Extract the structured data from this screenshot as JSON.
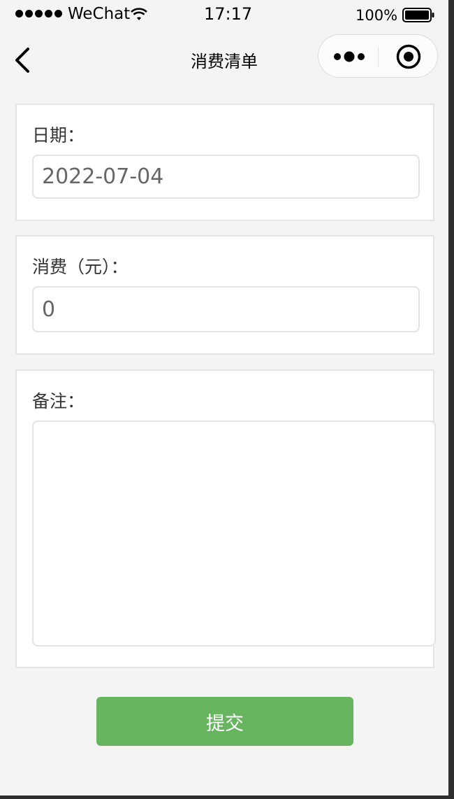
{
  "status_bar": {
    "carrier": "WeChat",
    "time": "17:17",
    "battery": "100%"
  },
  "nav": {
    "title": "消费清单"
  },
  "form": {
    "date_label": "日期：",
    "date_value": "2022-07-04",
    "amount_label": "消费（元）：",
    "amount_value": "0",
    "note_label": "备注：",
    "note_value": ""
  },
  "submit_label": "提交",
  "colors": {
    "accent": "#68b560",
    "background": "#f4f4f5"
  },
  "icons": [
    "signal-icon",
    "wifi-icon",
    "battery-icon",
    "back-icon",
    "more-icon",
    "close-miniprogram-icon"
  ]
}
